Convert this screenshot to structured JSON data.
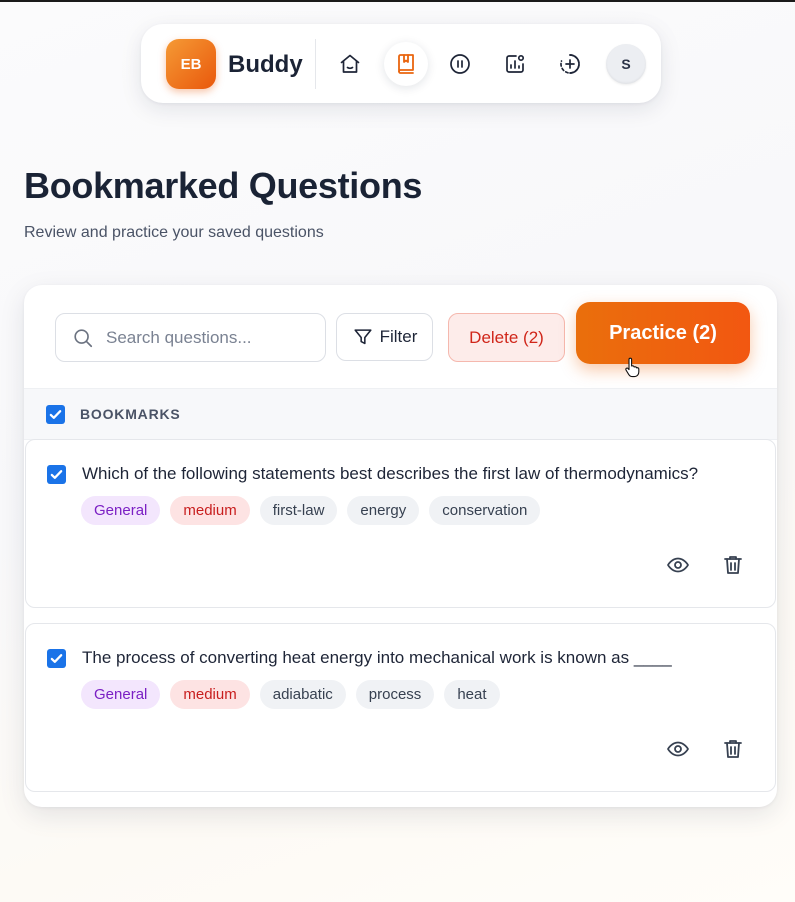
{
  "nav": {
    "logo_text": "EB",
    "brand": "Buddy",
    "icons": [
      "home-icon",
      "bookmark-book-icon",
      "pause-icon",
      "analytics-icon",
      "add-icon"
    ],
    "avatar_initial": "S"
  },
  "header": {
    "title": "Bookmarked Questions",
    "subtitle": "Review and practice your saved questions"
  },
  "toolbar": {
    "search_placeholder": "Search questions...",
    "filter_label": "Filter",
    "delete_label": "Delete (2)",
    "practice_label": "Practice (2)"
  },
  "list": {
    "header_label": "BOOKMARKS",
    "all_selected": true,
    "questions": [
      {
        "text": "Which of the following statements best describes the first law of thermodynamics?",
        "category": "General",
        "difficulty": "medium",
        "tags": [
          "first-law",
          "energy",
          "conservation"
        ],
        "selected": true
      },
      {
        "text": "The process of converting heat energy into mechanical work is known as ____",
        "category": "General",
        "difficulty": "medium",
        "tags": [
          "adiabatic",
          "process",
          "heat"
        ],
        "selected": true
      }
    ]
  },
  "colors": {
    "accent": "#ea6f0c",
    "checkbox": "#1a73e8",
    "delete_text": "#d0261a",
    "category_tag": "#7b20c4",
    "difficulty_tag": "#c81e1e"
  }
}
